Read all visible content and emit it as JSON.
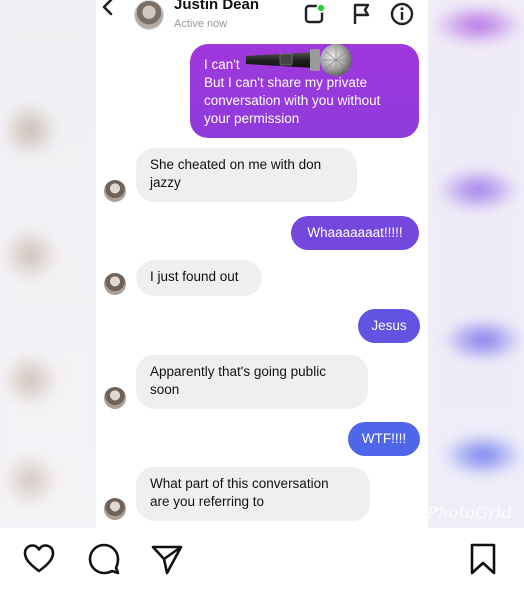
{
  "header": {
    "contact_name": "Justin Dean",
    "status": "Active now",
    "icons": [
      "back-chevron-icon",
      "video-call-icon",
      "flag-icon",
      "info-icon"
    ]
  },
  "messages": [
    {
      "sender": "me",
      "lines": [
        "I can't",
        "But I can't share my private",
        "conversation with you without",
        "your permission"
      ]
    },
    {
      "sender": "them",
      "lines": [
        "She cheated on me with don",
        "jazzy"
      ]
    },
    {
      "sender": "me",
      "lines": [
        "Whaaaaaaat!!!!!"
      ]
    },
    {
      "sender": "them",
      "lines": [
        "I just found out"
      ]
    },
    {
      "sender": "me",
      "lines": [
        "Jesus"
      ]
    },
    {
      "sender": "them",
      "lines": [
        "Apparently that's going public",
        "soon"
      ]
    },
    {
      "sender": "me",
      "lines": [
        "WTF!!!!"
      ]
    },
    {
      "sender": "them",
      "lines": [
        "What part of this conversation",
        "are you referring to"
      ]
    }
  ],
  "overlay": {
    "sticker": "microphone-sticker",
    "watermark": "PhotoGrid"
  },
  "bottom_bar": {
    "icons": [
      "heart-icon",
      "comment-icon",
      "share-icon",
      "bookmark-icon"
    ]
  },
  "colors": {
    "out_purple": "#9a35d9",
    "out_violet": "#6f52e0",
    "out_blue": "#4f65ea",
    "in_gray": "#efefef"
  }
}
